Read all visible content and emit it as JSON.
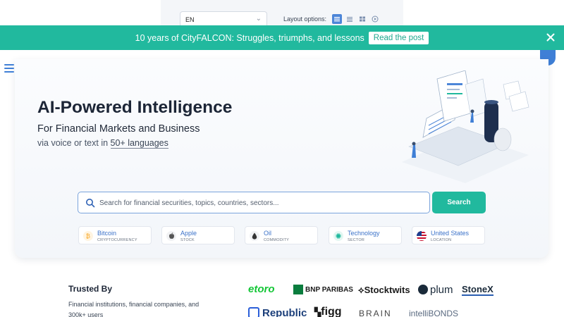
{
  "topbar": {
    "language": "EN",
    "layout_label": "Layout options:"
  },
  "banner": {
    "text": "10 years of CityFALCON: Struggles, triumphs, and lessons",
    "button": "Read the post"
  },
  "hero": {
    "title": "AI-Powered Intelligence",
    "subtitle": "For Financial Markets and Business",
    "sub2_prefix": "via voice or text in ",
    "sub2_link": "50+ languages"
  },
  "search": {
    "placeholder": "Search for financial securities, topics, countries, sectors...",
    "button": "Search"
  },
  "chips": [
    {
      "name": "Bitcoin",
      "type": "CRYPTOCURRENCY",
      "icon": "bitcoin-icon",
      "color": "#f7a21b"
    },
    {
      "name": "Apple",
      "type": "STOCK",
      "icon": "apple-icon",
      "color": "#555555"
    },
    {
      "name": "Oil",
      "type": "COMMODITY",
      "icon": "oil-drop-icon",
      "color": "#333333"
    },
    {
      "name": "Technology",
      "type": "SECTOR",
      "icon": "chip-icon",
      "color": "#21b99e"
    },
    {
      "name": "United States",
      "type": "LOCATION",
      "icon": "us-flag-icon",
      "color": "#c8102e"
    }
  ],
  "trusted": {
    "title": "Trusted By",
    "desc": "Financial institutions, financial companies, and 300k+ users"
  },
  "partners": [
    "etoro",
    "BNP PARIBAS",
    "Stocktwits",
    "plum",
    "StoneX",
    "Republic",
    "figg",
    "BRAIN",
    "intelliBONDS"
  ],
  "colors": {
    "accent": "#21b99e",
    "link": "#3b72c9",
    "brand_blue": "#3f7fd6"
  }
}
